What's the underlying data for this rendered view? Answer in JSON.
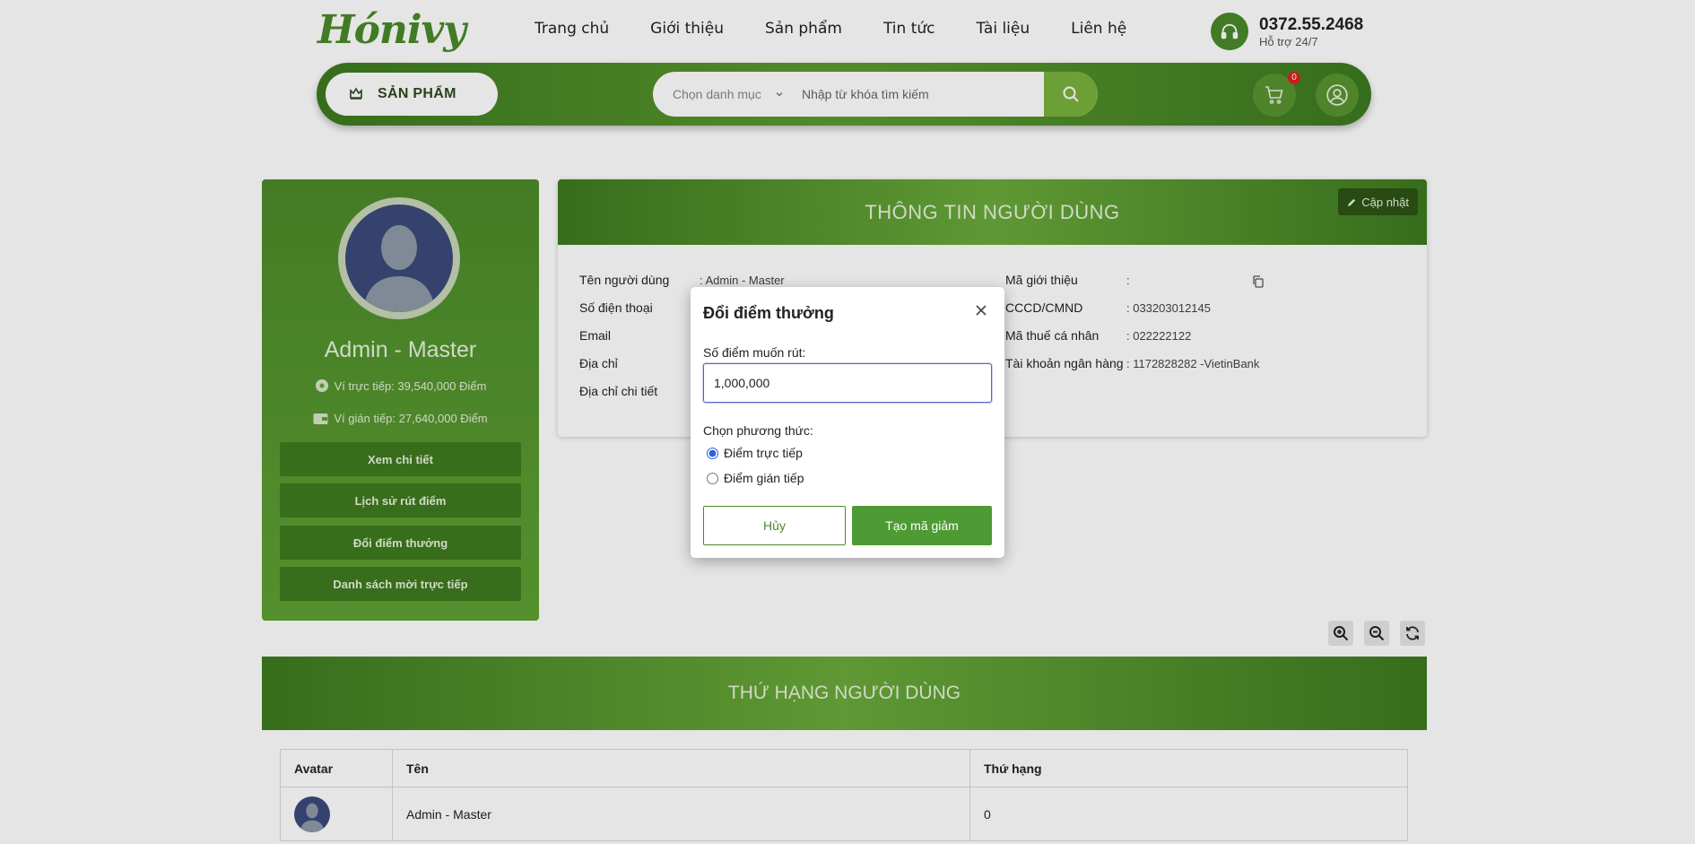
{
  "header": {
    "logo_text": "Hónivy",
    "nav": [
      "Trang chủ",
      "Giới thiệu",
      "Sản phẩm",
      "Tin tức",
      "Tài liệu",
      "Liên hệ"
    ],
    "hotline": "0372.55.2468",
    "hotline_sub": "Hỗ trợ 24/7",
    "products_button": "SẢN PHẨM",
    "category_placeholder": "Chọn danh mục",
    "search_placeholder": "Nhập từ khóa tìm kiếm",
    "cart_count": "0"
  },
  "profile": {
    "name": "Admin - Master",
    "direct_wallet": "Ví trực tiếp: 39,540,000 Điểm",
    "indirect_wallet": "Ví gián tiếp: 27,640,000 Điểm",
    "buttons": [
      "Xem chi tiết",
      "Lịch sử rút điểm",
      "Đổi điểm thưởng",
      "Danh sách mời trực tiếp"
    ]
  },
  "info": {
    "title": "THÔNG TIN NGƯỜI DÙNG",
    "update_button": "Cập nhật",
    "left_fields": [
      {
        "label": "Tên người dùng",
        "value": ": Admin - Master"
      },
      {
        "label": "Số điện thoại",
        "value": ""
      },
      {
        "label": "Email",
        "value": ""
      },
      {
        "label": "Địa chỉ",
        "value": ""
      },
      {
        "label": "Địa chỉ chi tiết",
        "value": ""
      }
    ],
    "right_fields": [
      {
        "label": "Mã giới thiệu",
        "value": ":"
      },
      {
        "label": "CCCD/CMND",
        "value": ": 033203012145"
      },
      {
        "label": "Mã thuế cá nhân",
        "value": ": 022222122"
      },
      {
        "label": "Tài khoản ngân hàng",
        "value": ": 1172828282 -VietinBank"
      }
    ]
  },
  "rank": {
    "title": "THỨ HẠNG NGƯỜI DÙNG",
    "columns": [
      "Avatar",
      "Tên",
      "Thứ hạng"
    ],
    "rows": [
      {
        "name": "Admin - Master",
        "rank": "0"
      }
    ]
  },
  "modal": {
    "title": "Đổi điểm thưởng",
    "amount_label": "Số điểm muốn rút:",
    "amount_value": "1,000,000",
    "method_label": "Chọn phương thức:",
    "options": [
      "Điểm trực tiếp",
      "Điểm gián tiếp"
    ],
    "selected_option": "Điểm trực tiếp",
    "cancel_button": "Hủy",
    "submit_button": "Tạo mã giảm"
  },
  "colors": {
    "brand_green": "#4a8a2a",
    "accent_light_green": "#7ab23e",
    "badge_red": "#e02020"
  }
}
